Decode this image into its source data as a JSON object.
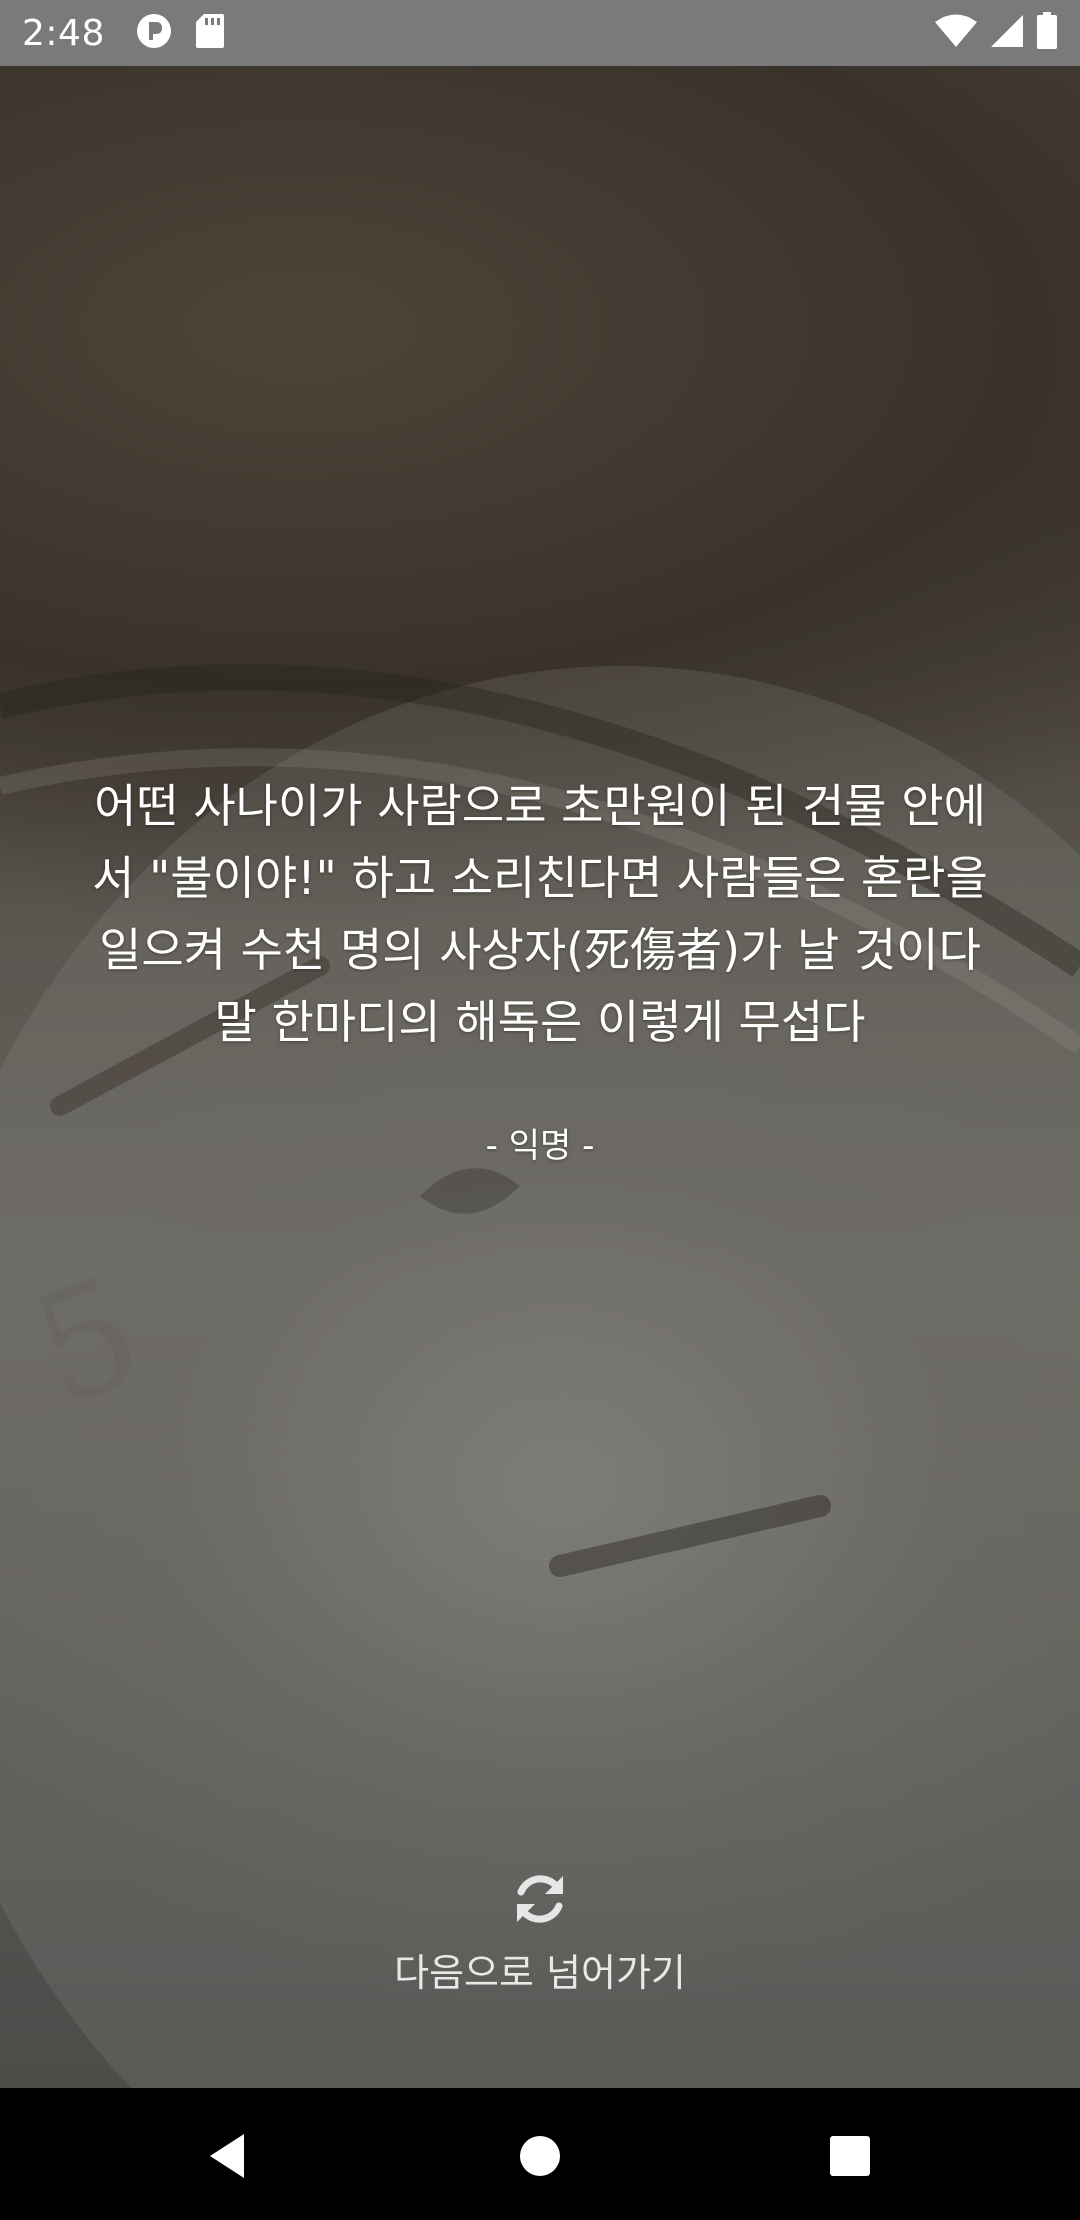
{
  "status_bar": {
    "time": "2:48",
    "icons": [
      "app-notification-icon",
      "sd-card-icon",
      "wifi-icon",
      "cell-signal-icon",
      "battery-icon"
    ]
  },
  "quote": {
    "text": "어떤 사나이가 사람으로 초만원이 된 건물 안에서 \"불이야!\" 하고 소리친다면 사람들은 혼란을 일으켜 수천 명의 사상자(死傷者)가 날 것이다 말 한마디의 해독은 이렇게 무섭다",
    "author": "- 익명 -"
  },
  "next_button": {
    "icon": "refresh-icon",
    "label": "다음으로 넘어가기"
  },
  "nav_bar": {
    "back": "back-icon",
    "home": "home-icon",
    "recents": "recents-icon"
  },
  "colors": {
    "status_bar_bg": "#7a7a7a",
    "text": "#ffffff",
    "nav_bar_bg": "#000000"
  }
}
